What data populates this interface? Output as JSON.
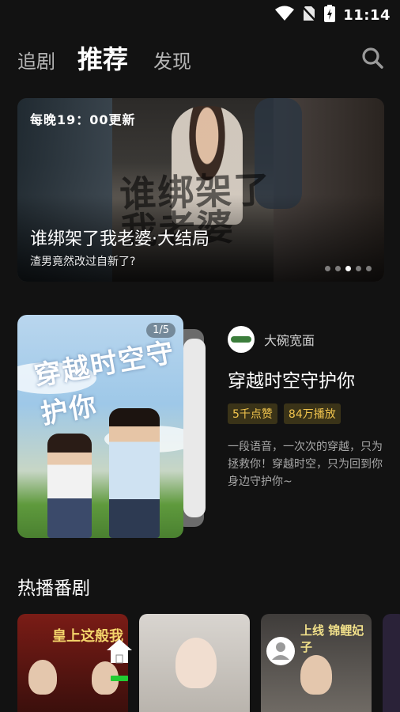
{
  "status_bar": {
    "time": "11:14",
    "icons": [
      "wifi-icon",
      "no-sim-icon",
      "battery-charging-icon"
    ]
  },
  "nav": {
    "tabs": [
      {
        "label": "追剧",
        "active": false
      },
      {
        "label": "推荐",
        "active": true
      },
      {
        "label": "发现",
        "active": false
      }
    ],
    "search_icon": "search-icon"
  },
  "banner": {
    "badge": "每晚19：00更新",
    "poster_text": "谁绑架了我老婆",
    "title": "谁绑架了我老婆·大结局",
    "subtitle": "渣男竟然改过自新了?",
    "dots": 5,
    "active_dot": 3
  },
  "feature": {
    "page_indicator": "1/5",
    "poster_art_text": "穿越时空守护你",
    "author": "大碗宽面",
    "title": "穿越时空守护你",
    "tags": [
      "5千点赞",
      "84万播放"
    ],
    "description": "一段语音，一次次的穿越，只为拯救你！穿越时空，只为回到你身边守护你~"
  },
  "hot_section": {
    "title": "热播番剧",
    "cards": [
      {
        "art_text": "皇上这般我"
      },
      {
        "art_text": ""
      },
      {
        "art_text": "上线 锦鲤妃子"
      }
    ]
  },
  "tabbar": {
    "items": [
      "home-icon",
      "profile-icon"
    ],
    "active": "home-icon",
    "active_color": "#22cc33"
  },
  "colors": {
    "background": "#121212",
    "tag_bg": "#3a3318",
    "tag_text": "#f1c44d"
  }
}
